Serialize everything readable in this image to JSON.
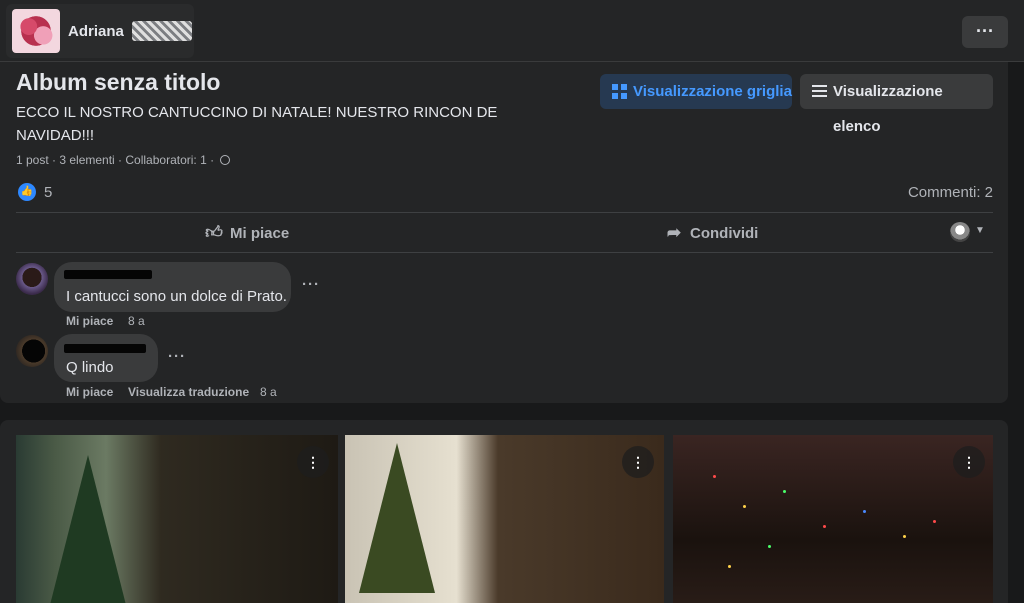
{
  "header": {
    "user_name": "Adriana",
    "more_label": "···"
  },
  "album": {
    "title": "Album senza titolo",
    "description": "ECCO IL NOSTRO CANTUCCINO DI NATALE! NUESTRO RINCON DE NAVIDAD!!!",
    "meta": "1 post · 3 elementi · Collaboratori: 1 ·",
    "grid_view_label": "Visualizzazione griglia",
    "list_view_label": "Visualizzazione elenco"
  },
  "reactions": {
    "like_count": "5",
    "comments_count": "Commenti: 2"
  },
  "actions": {
    "like_label": "Mi piace",
    "share_label": "Condividi"
  },
  "comments": [
    {
      "text": "I cantucci sono un dolce di Prato.",
      "like_label": "Mi piace",
      "time": "8 a"
    },
    {
      "text": "Q lindo",
      "like_label": "Mi piace",
      "translate_label": "Visualizza traduzione",
      "time": "8 a"
    }
  ],
  "icons": {
    "more": "more-horizontal-icon",
    "like": "thumbs-up-icon",
    "share": "share-icon",
    "grid": "grid-icon",
    "list": "list-icon"
  },
  "colors": {
    "accent": "#4599ff",
    "background": "#18191a",
    "card": "#242526"
  }
}
